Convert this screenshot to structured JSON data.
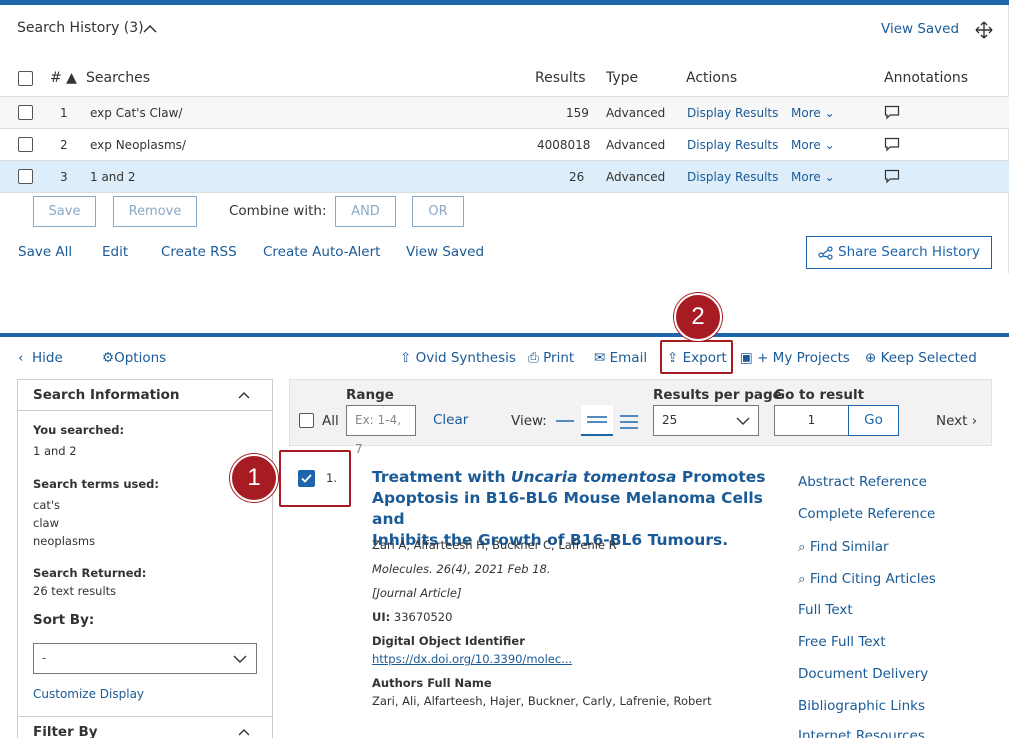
{
  "history": {
    "title": "Search History (3)",
    "view_saved_top": "View Saved",
    "columns": {
      "num": "# ▲",
      "searches": "Searches",
      "results": "Results",
      "type": "Type",
      "actions": "Actions",
      "annotations": "Annotations"
    },
    "rows": [
      {
        "num": "1",
        "query": "exp Cat's Claw/",
        "results": "159",
        "type": "Advanced",
        "display": "Display Results",
        "more": "More"
      },
      {
        "num": "2",
        "query": "exp Neoplasms/",
        "results": "4008018",
        "type": "Advanced",
        "display": "Display Results",
        "more": "More"
      },
      {
        "num": "3",
        "query": "1 and 2",
        "results": "26",
        "type": "Advanced",
        "display": "Display Results",
        "more": "More"
      }
    ],
    "save_btn": "Save",
    "remove_btn": "Remove",
    "combine_label": "Combine with:",
    "and_btn": "AND",
    "or_btn": "OR",
    "links": {
      "save_all": "Save All",
      "edit": "Edit",
      "create_rss": "Create RSS",
      "create_auto_alert": "Create Auto-Alert",
      "view_saved": "View Saved"
    },
    "share": "Share Search History"
  },
  "toolbar": {
    "hide": "Hide",
    "options": "Options",
    "ovid_synthesis": "Ovid Synthesis",
    "print": "Print",
    "email": "Email",
    "export": "Export",
    "my_projects": "+ My Projects",
    "keep_selected": "Keep Selected"
  },
  "badges": {
    "one": "1",
    "two": "2"
  },
  "sidebar": {
    "search_info_title": "Search Information",
    "you_searched_label": "You searched:",
    "you_searched_value": "1 and 2",
    "terms_label": "Search terms used:",
    "terms": [
      "cat's",
      "claw",
      "neoplasms"
    ],
    "returned_label": "Search Returned:",
    "returned_value": "26 text results",
    "sort_by_label": "Sort By:",
    "sort_value": "-",
    "customize": "Customize Display",
    "filter_by": "Filter By"
  },
  "controls": {
    "all": "All",
    "range_label": "Range",
    "range_placeholder": "Ex: 1-4, 7",
    "clear": "Clear",
    "view_label": "View:",
    "rpp_label": "Results per page",
    "rpp_value": "25",
    "goto_label": "Go to result",
    "goto_value": "1",
    "go": "Go",
    "next": "Next"
  },
  "result": {
    "index": "1.",
    "title_a": "Treatment with ",
    "title_italic": "Uncaria tomentosa",
    "title_b": " Promotes",
    "title_line2": "Apoptosis in B16-BL6 Mouse Melanoma Cells and",
    "title_line3": "Inhibits the Growth of B16-BL6 Tumours.",
    "authors": "Zari A, Alfarteesh H, Buckner C, Lafrenie R",
    "source": "Molecules. 26(4), 2021 Feb 18.",
    "pubtype": "[Journal Article]",
    "ui_label": "UI:",
    "ui_value": "33670520",
    "doi_label": "Digital Object Identifier",
    "doi_link": "https://dx.doi.org/10.3390/molec...",
    "afn_label": "Authors Full Name",
    "afn_value": "Zari, Ali, Alfarteesh, Hajer, Buckner, Carly, Lafrenie, Robert",
    "links": [
      "Abstract Reference",
      "Complete Reference",
      "Find Similar",
      "Find Citing Articles",
      "Full Text",
      "Free Full Text",
      "Document Delivery",
      "Bibliographic Links",
      "Internet Resources"
    ]
  },
  "colors": {
    "brand": "#1d66ac",
    "link": "#1a5a96",
    "highlight": "#a71b22",
    "selected_row": "#ddeefa"
  }
}
